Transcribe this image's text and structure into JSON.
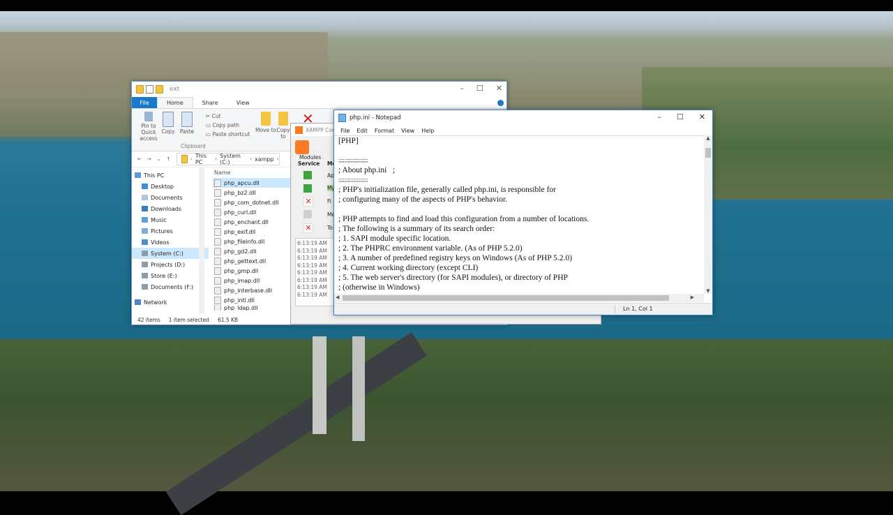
{
  "explorer": {
    "title": "ext",
    "tabs": [
      "File",
      "Home",
      "Share",
      "View"
    ],
    "ribbon": {
      "pin": "Pin to Quick access",
      "copy": "Copy",
      "paste": "Paste",
      "cut": "Cut",
      "copy_path": "Copy path",
      "paste_shortcut": "Paste shortcut",
      "clipboard": "Clipboard",
      "move_to": "Move to",
      "copy_to": "Copy to"
    },
    "breadcrumb": [
      "This PC",
      "System (C:)",
      "xampp"
    ],
    "nav": [
      "This PC",
      "Desktop",
      "Documents",
      "Downloads",
      "Music",
      "Pictures",
      "Videos",
      "System (C:)",
      "Projects (D:)",
      "Store (E:)",
      "Documents (F:)",
      "Network"
    ],
    "column_header": "Name",
    "files": [
      "php_apcu.dll",
      "php_bz2.dll",
      "php_com_dotnet.dll",
      "php_curl.dll",
      "php_enchant.dll",
      "php_exif.dll",
      "php_fileinfo.dll",
      "php_gd2.dll",
      "php_gettext.dll",
      "php_gmp.dll",
      "php_imap.dll",
      "php_interbase.dll",
      "php_intl.dll",
      "php_ldap.dll"
    ],
    "status_items": "42 items",
    "status_selected": "1 item selected",
    "status_size": "61.5 KB"
  },
  "xampp": {
    "title": "XAMPP Con",
    "modules_label": "Modules",
    "service_label": "Service",
    "module_col": "Mo",
    "rows": [
      "Ap",
      "My",
      "Fi",
      "Me",
      "To"
    ],
    "log_times": [
      "6:13:19 AM",
      "6:13:19 AM",
      "6:13:19 AM",
      "6:13:19 AM",
      "6:13:19 AM",
      "6:13:19 AM",
      "6:13:19 AM",
      "6:13:19 AM"
    ]
  },
  "notepad": {
    "title": "php.ini - Notepad",
    "menu": [
      "File",
      "Edit",
      "Format",
      "View",
      "Help"
    ],
    "lines": [
      "[PHP]",
      "",
      ";;;;;;;;;;;;;;;;;;;",
      "; About php.ini   ;",
      ";;;;;;;;;;;;;;;;;;;",
      "; PHP's initialization file, generally called php.ini, is responsible for",
      "; configuring many of the aspects of PHP's behavior.",
      "",
      "; PHP attempts to find and load this configuration from a number of locations.",
      "; The following is a summary of its search order:",
      "; 1. SAPI module specific location.",
      "; 2. The PHPRC environment variable. (As of PHP 5.2.0)",
      "; 3. A number of predefined registry keys on Windows (As of PHP 5.2.0)",
      "; 4. Current working directory (except CLI)",
      "; 5. The web server's directory (for SAPI modules), or directory of PHP",
      "; (otherwise in Windows)"
    ],
    "status": "Ln 1, Col 1"
  }
}
